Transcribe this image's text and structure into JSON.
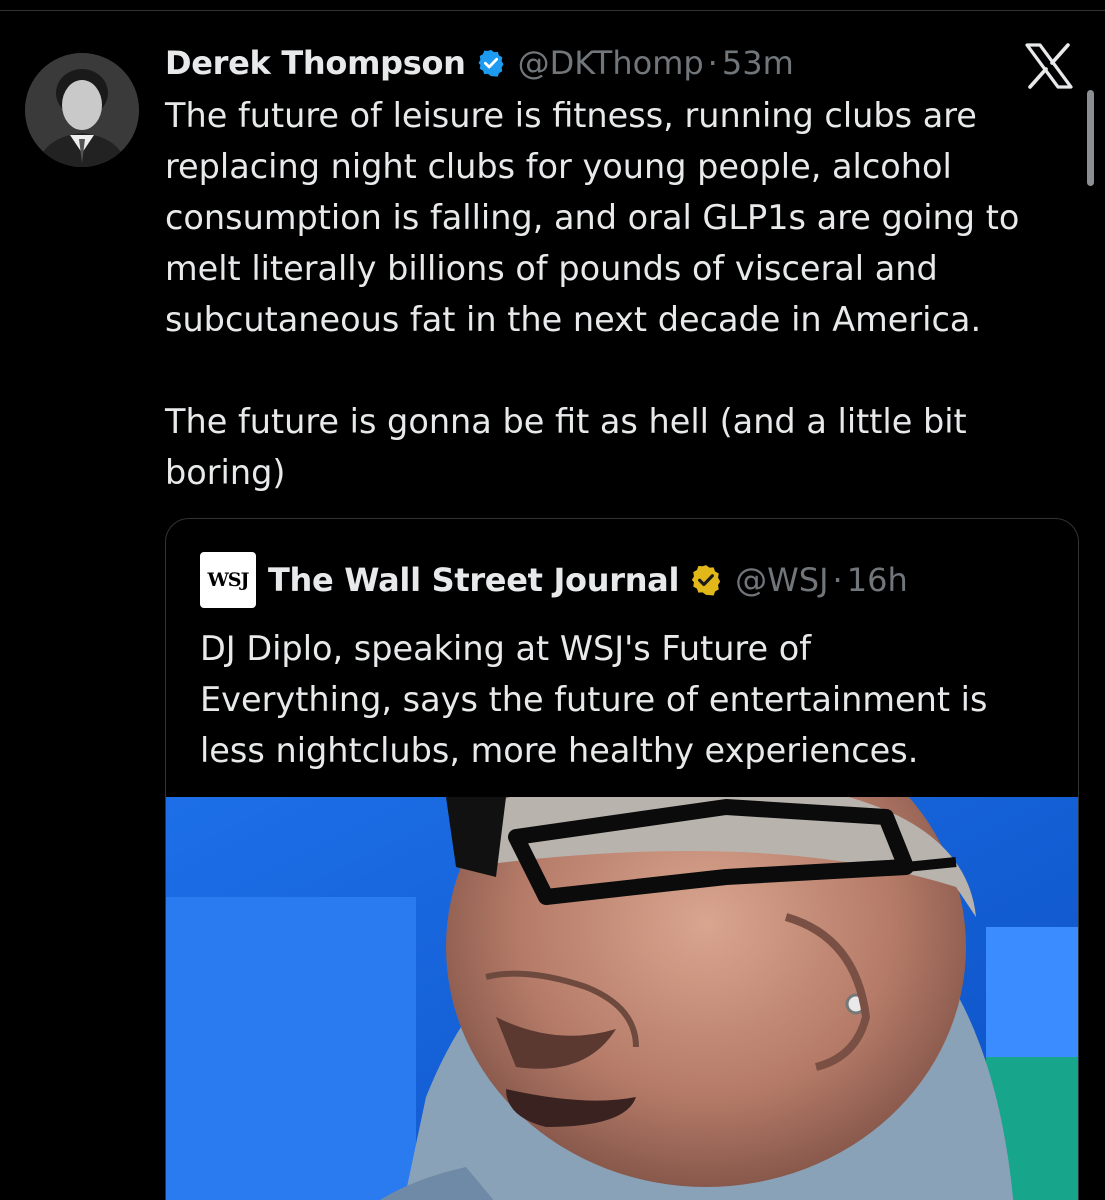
{
  "post": {
    "author_name": "Derek Thompson",
    "handle": "@DKThomp",
    "separator": "·",
    "time": "53m",
    "text_lines": [
      "The future of leisure is fitness, running clubs are",
      "replacing night clubs for young people, alcohol",
      "consumption is falling, and oral GLP1s are going to",
      "melt literally billions of pounds of visceral and",
      "subcutaneous fat in the next decade in America."
    ],
    "text_lines_2": [
      "The future is gonna be fit as hell (and a little bit",
      "boring)"
    ],
    "verified_color": "#1d9bf0",
    "icons": [
      "avatar",
      "verified-badge-icon",
      "x-logo-icon"
    ]
  },
  "quote": {
    "logo_text": "WSJ",
    "author_name": "The Wall Street Journal",
    "handle": "@WSJ",
    "separator": "·",
    "time": "16h",
    "text_lines": [
      "DJ Diplo, speaking at WSJ's Future of",
      "Everything, says the future of entertainment is",
      "less nightclubs, more healthy experiences."
    ],
    "verified_color": "#e2b719",
    "icons": [
      "wsj-logo",
      "gold-verified-badge-icon",
      "video-thumbnail"
    ]
  },
  "colors": {
    "background": "#000000",
    "primary_text": "#e7e9ea",
    "secondary_text": "#71767b",
    "border": "#2f3336"
  }
}
